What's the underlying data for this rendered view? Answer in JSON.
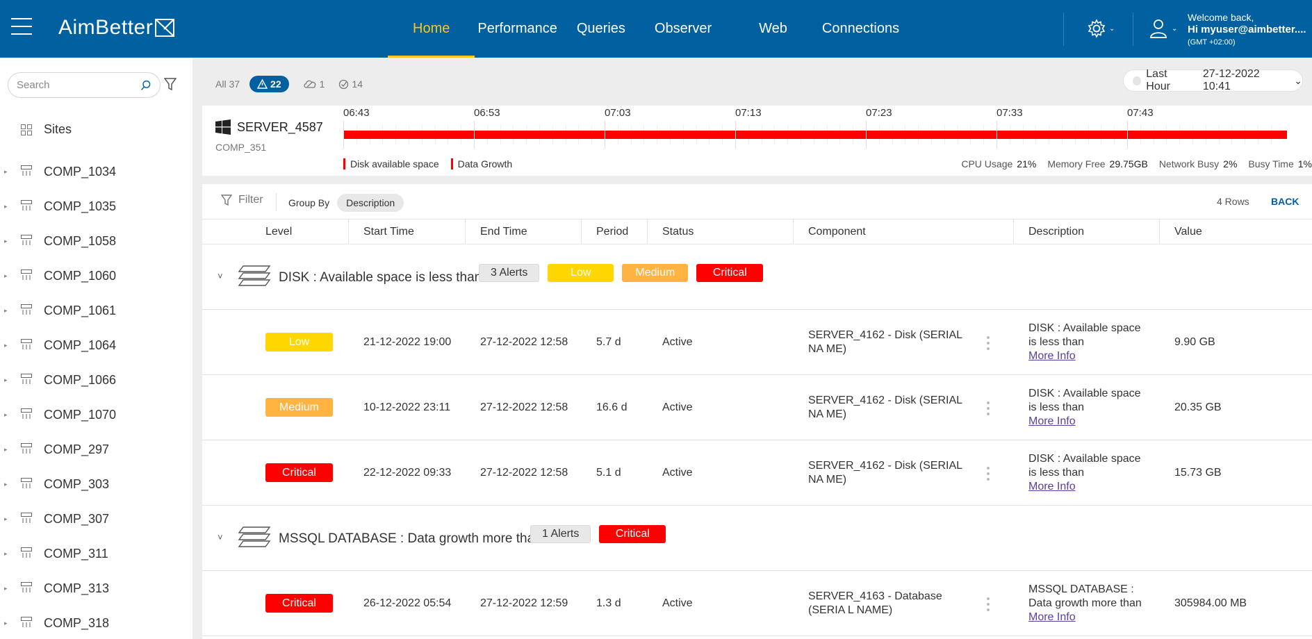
{
  "header": {
    "brand": "AimBetter",
    "nav": [
      {
        "label": "Home",
        "active": true
      },
      {
        "label": "Performance",
        "active": false
      },
      {
        "label": "Queries",
        "active": false
      },
      {
        "label": "Observer",
        "active": false
      },
      {
        "label": "Web",
        "active": false
      },
      {
        "label": "Connections",
        "active": false
      }
    ],
    "user": {
      "welcome": "Welcome back,",
      "name": "Hi myuser@aimbetter....",
      "timezone": "(GMT +02:00)"
    },
    "colors": {
      "bar": "#0160a0",
      "active_nav": "#ffc51a"
    }
  },
  "sidebar": {
    "search_placeholder": "Search",
    "sites_label": "Sites",
    "items": [
      "COMP_1034",
      "COMP_1035",
      "COMP_1058",
      "COMP_1060",
      "COMP_1061",
      "COMP_1064",
      "COMP_1066",
      "COMP_1070",
      "COMP_297",
      "COMP_303",
      "COMP_307",
      "COMP_311",
      "COMP_313",
      "COMP_318"
    ]
  },
  "filters": {
    "all": "All 37",
    "alerts": "22",
    "cloud": "1",
    "resolved": "14"
  },
  "timepicker": {
    "range": "Last Hour",
    "date": "27-12-2022 10:41"
  },
  "server": {
    "name": "SERVER_4587",
    "comp": "COMP_351",
    "os_icon": "windows-icon",
    "timeline_ticks": [
      "06:43",
      "06:53",
      "07:03",
      "07:13",
      "07:23",
      "07:33",
      "07:43"
    ],
    "legend": [
      "Disk available space",
      "Data Growth"
    ],
    "metrics": [
      {
        "label": "CPU Usage",
        "value": "21%"
      },
      {
        "label": "Memory Free",
        "value": "29.75GB"
      },
      {
        "label": "Network Busy",
        "value": "2%"
      },
      {
        "label": "Busy Time",
        "value": "1%"
      }
    ]
  },
  "table": {
    "filter_label": "Filter",
    "group_by_label": "Group By",
    "group_by_value": "Description",
    "rows_count": "4 Rows",
    "back_label": "BACK",
    "columns": [
      "Level",
      "Start Time",
      "End Time",
      "Period",
      "Status",
      "Component",
      "Description",
      "Value"
    ],
    "level_colors": {
      "Low": "#ffd700",
      "Medium": "#ffb340",
      "Critical": "#ff0000"
    },
    "groups": [
      {
        "title": "DISK : Available space is less than",
        "alerts_badge": "3 Alerts",
        "levels": [
          "Low",
          "Medium",
          "Critical"
        ],
        "rows": [
          {
            "level": "Low",
            "start": "21-12-2022 19:00",
            "end": "27-12-2022 12:58",
            "period": "5.7 d",
            "status": "Active",
            "component": "SERVER_4162 - Disk (SERIAL NA ME)",
            "description": "DISK : Available space is less than",
            "more": "More Info",
            "value": "9.90 GB"
          },
          {
            "level": "Medium",
            "start": "10-12-2022 23:11",
            "end": "27-12-2022 12:58",
            "period": "16.6 d",
            "status": "Active",
            "component": "SERVER_4162 - Disk (SERIAL NA ME)",
            "description": "DISK : Available space is less than",
            "more": "More Info",
            "value": "20.35 GB"
          },
          {
            "level": "Critical",
            "start": "22-12-2022 09:33",
            "end": "27-12-2022 12:58",
            "period": "5.1 d",
            "status": "Active",
            "component": "SERVER_4162 - Disk (SERIAL NA ME)",
            "description": "DISK : Available space is less than",
            "more": "More Info",
            "value": "15.73 GB"
          }
        ]
      },
      {
        "title": "MSSQL DATABASE : Data growth more than",
        "alerts_badge": "1 Alerts",
        "levels": [
          "Critical"
        ],
        "rows": [
          {
            "level": "Critical",
            "start": "26-12-2022 05:54",
            "end": "27-12-2022 12:59",
            "period": "1.3 d",
            "status": "Active",
            "component": "SERVER_4163 - Database (SERIA L NAME)",
            "description": "MSSQL DATABASE : Data growth more than",
            "more": "More Info",
            "value": "305984.00 MB"
          }
        ]
      }
    ]
  }
}
